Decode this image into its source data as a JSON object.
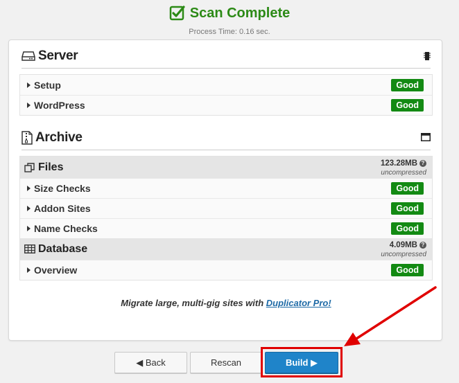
{
  "header": {
    "title": "Scan Complete",
    "process_time": "Process Time: 0.16 sec."
  },
  "server": {
    "title": "Server",
    "rows": [
      {
        "label": "Setup",
        "status": "Good"
      },
      {
        "label": "WordPress",
        "status": "Good"
      }
    ]
  },
  "archive": {
    "title": "Archive",
    "files": {
      "title": "Files",
      "size": "123.28MB",
      "size_note": "uncompressed",
      "rows": [
        {
          "label": "Size Checks",
          "status": "Good"
        },
        {
          "label": "Addon Sites",
          "status": "Good"
        },
        {
          "label": "Name Checks",
          "status": "Good"
        }
      ]
    },
    "database": {
      "title": "Database",
      "size": "4.09MB",
      "size_note": "uncompressed",
      "rows": [
        {
          "label": "Overview",
          "status": "Good"
        }
      ]
    }
  },
  "promo": {
    "text": "Migrate large, multi-gig sites with ",
    "link": "Duplicator Pro!"
  },
  "buttons": {
    "back": "◀ Back",
    "rescan": "Rescan",
    "build": "Build ▶"
  },
  "icons": {
    "check": "check-square-icon",
    "server": "hdd-icon",
    "server_right": "chip-icon",
    "archive": "zip-file-icon",
    "archive_right": "window-icon",
    "files": "copy-icon",
    "database": "table-icon"
  },
  "colors": {
    "success": "#2c8a16",
    "badge": "#138a13",
    "primary": "#1f84c9",
    "highlight": "#e00000",
    "link": "#1e6aa6"
  }
}
